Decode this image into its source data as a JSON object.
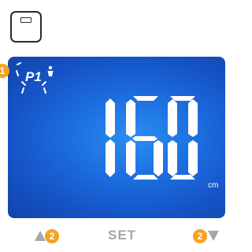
{
  "device": {
    "scale_icon": "scale-icon"
  },
  "display": {
    "profile_label": "P1",
    "value": "160",
    "unit": "cm",
    "background_color": "#1c6fe0",
    "segment_color": "#ffffff"
  },
  "controls": {
    "up_badge": "2",
    "set_label": "SET",
    "down_badge": "2",
    "arrow_color": "#a3a7ab"
  },
  "callouts": {
    "profile_badge": "1",
    "badge_color": "#f4a21f"
  }
}
